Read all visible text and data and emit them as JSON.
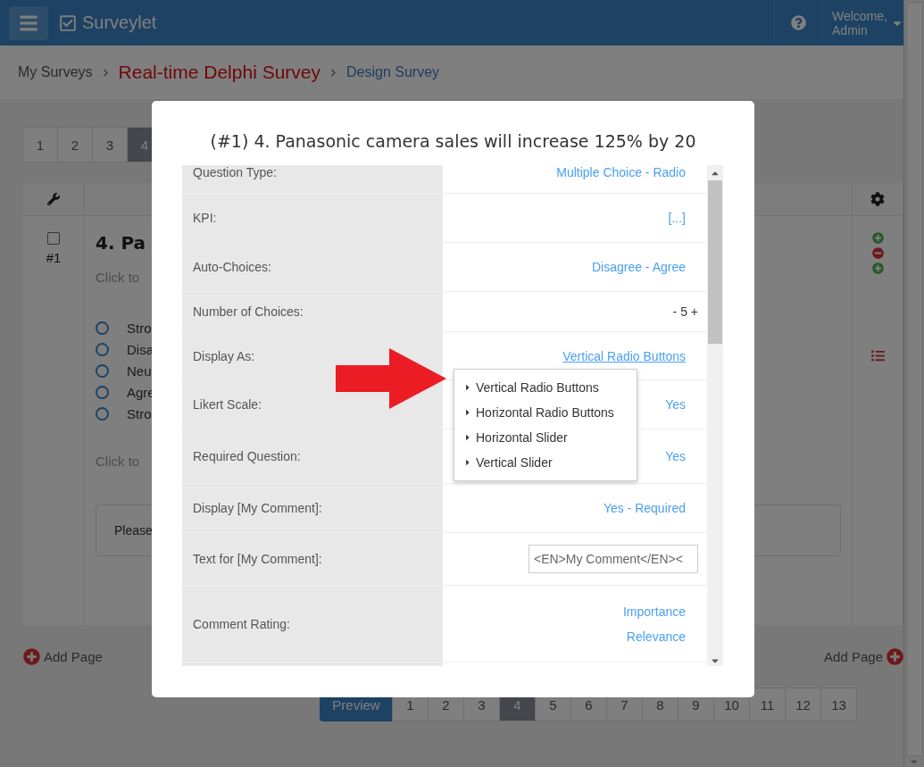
{
  "navbar": {
    "brand": "Surveylet",
    "welcome": "Welcome,",
    "user": "Admin"
  },
  "breadcrumb": [
    {
      "label": "My Surveys",
      "kind": "plain"
    },
    {
      "label": "Real-time Delphi Survey",
      "kind": "survey"
    },
    {
      "label": "Design Survey",
      "kind": "current"
    }
  ],
  "page_tabs": [
    {
      "label": "1",
      "selected": false
    },
    {
      "label": "2",
      "selected": false
    },
    {
      "label": "3",
      "selected": false
    },
    {
      "label": "4",
      "selected": true
    }
  ],
  "question_card": {
    "checked": false,
    "number": "#1",
    "title": "4. Pa",
    "hint_top": "Click to",
    "options": [
      {
        "label": "Stro",
        "selected": false
      },
      {
        "label": "Disa",
        "selected": false
      },
      {
        "label": "Neu",
        "selected": false
      },
      {
        "label": "Agre",
        "selected": false
      },
      {
        "label": "Stro",
        "selected": false
      }
    ],
    "hint_bottom": "Click to",
    "comment_box": "Please"
  },
  "add_page_left": "Add Page",
  "add_page_right": "Add Page",
  "pagination": {
    "preview": "Preview",
    "pages": [
      {
        "label": "1",
        "selected": false
      },
      {
        "label": "2",
        "selected": false
      },
      {
        "label": "3",
        "selected": false
      },
      {
        "label": "4",
        "selected": true
      },
      {
        "label": "5",
        "selected": false
      },
      {
        "label": "6",
        "selected": false
      },
      {
        "label": "7",
        "selected": false
      },
      {
        "label": "8",
        "selected": false
      },
      {
        "label": "9",
        "selected": false
      },
      {
        "label": "10",
        "selected": false
      },
      {
        "label": "11",
        "selected": false
      },
      {
        "label": "12",
        "selected": false
      },
      {
        "label": "13",
        "selected": false
      }
    ]
  },
  "modal": {
    "title": "(#1) 4. Panasonic camera sales will increase 125% by 20",
    "rows": [
      {
        "kind": "link",
        "label": "Question Type:",
        "values": [
          "Multiple Choice - Radio"
        ]
      },
      {
        "kind": "link",
        "label": "KPI:",
        "values": [
          "[...]"
        ]
      },
      {
        "kind": "link",
        "label": "Auto-Choices:",
        "values": [
          "Disagree - Agree"
        ]
      },
      {
        "kind": "stepper",
        "label": "Number of Choices:",
        "values": [
          "- 5 +"
        ]
      },
      {
        "kind": "dropdown",
        "label": "Display As:",
        "values": [
          "Vertical Radio Buttons"
        ]
      },
      {
        "kind": "link",
        "label": "Likert Scale:",
        "values": [
          "Yes"
        ]
      },
      {
        "kind": "link",
        "label": "Required Question:",
        "values": [
          "Yes"
        ]
      },
      {
        "kind": "link",
        "label": "Display [My Comment]:",
        "values": [
          "Yes - Required"
        ]
      },
      {
        "kind": "input",
        "label": "Text for [My Comment]:",
        "values": [
          "<EN>My Comment</EN><"
        ]
      },
      {
        "kind": "link",
        "label": "Comment Rating:",
        "values": [
          "Importance",
          "Relevance"
        ]
      }
    ],
    "menu": [
      {
        "label": "Vertical Radio Buttons"
      },
      {
        "label": "Horizontal Radio Buttons"
      },
      {
        "label": "Horizontal Slider"
      },
      {
        "label": "Vertical Slider"
      }
    ]
  }
}
